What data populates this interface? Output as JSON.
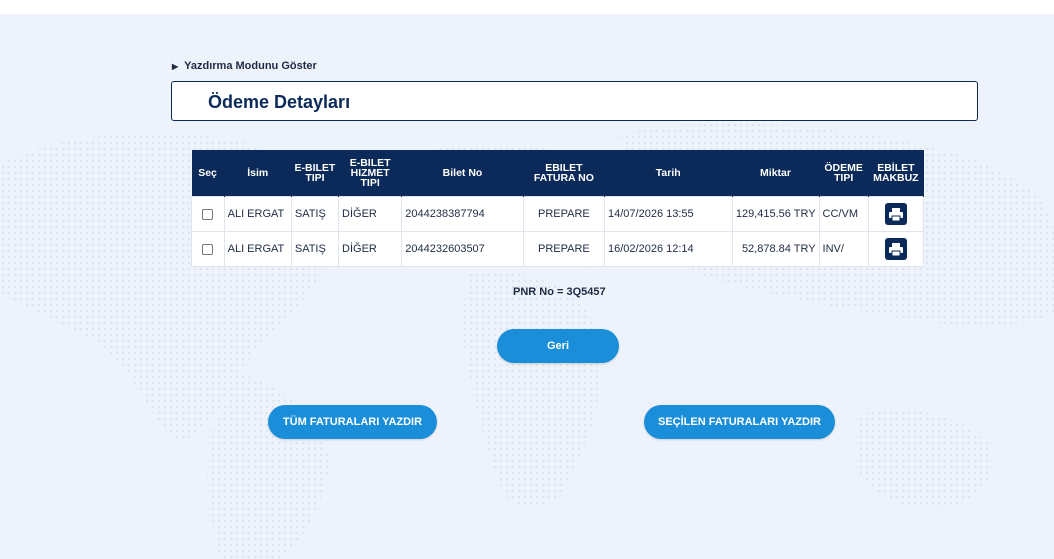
{
  "print_mode": {
    "label": "Yazdırma Modunu Göster"
  },
  "page_title": "Ödeme Detayları",
  "table": {
    "headers": {
      "sec": "Seç",
      "isim": "İsim",
      "ebilet_tipi_1": "E-BILET",
      "ebilet_tipi_2": "TIPI",
      "hizmet_1": "E-BILET",
      "hizmet_2": "HIZMET",
      "hizmet_3": "TIPI",
      "bilet_no": "Bilet No",
      "fatura_1": "EBILET",
      "fatura_2": "FATURA NO",
      "tarih": "Tarih",
      "miktar": "Miktar",
      "odeme_1": "ÖDEME",
      "odeme_2": "TIPI",
      "makbuz_1": "EBİLET",
      "makbuz_2": "MAKBUZ"
    },
    "rows": [
      {
        "isim": "ALI ERGAT",
        "tip": "SATIŞ",
        "hizmet": "DİĞER",
        "bilet_no": "2044238387794",
        "fatura": "PREPARE",
        "tarih": "14/07/2026 13:55",
        "miktar": "129,415.56 TRY",
        "odeme": "CC/VM"
      },
      {
        "isim": "ALI ERGAT",
        "tip": "SATIŞ",
        "hizmet": "DİĞER",
        "bilet_no": "2044232603507",
        "fatura": "PREPARE",
        "tarih": "16/02/2026 12:14",
        "miktar": "52,878.84 TRY",
        "odeme": "INV/"
      }
    ]
  },
  "pnr": "PNR No = 3Q5457",
  "buttons": {
    "back": "Geri",
    "print_all": "TÜM FATURALARI YAZDIR",
    "print_selected": "SEÇİLEN FATURALARI YAZDIR"
  },
  "colors": {
    "navy": "#0b2a59",
    "accent": "#1a8ed8",
    "background": "#eef3fb"
  }
}
